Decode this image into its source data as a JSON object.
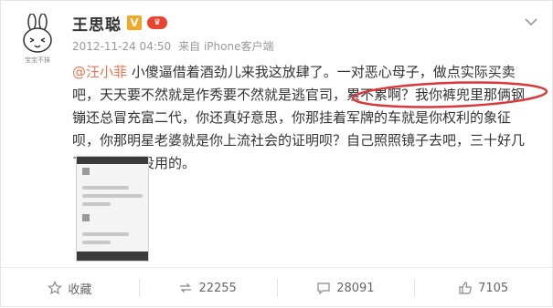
{
  "user": {
    "name": "王思聪",
    "verified_badge": "V",
    "avatar_caption": "宝宝不抹",
    "verified_color": "#f5a623",
    "vip_color": "#e8452f"
  },
  "meta": {
    "timestamp": "2012-11-24 04:50",
    "source": "来自 iPhone客户端"
  },
  "post": {
    "mention": "@汪小菲",
    "text": " 小傻逼借着酒劲儿来我这放肆了。一对恶心母子，做点实际买卖吧，天天要不然就是作秀要不然就是逃官司，累不累啊？我你裤兜里那俩钢镚还总冒充富二代，你还真好意思，你那挂着军牌的车就是你权利的象征呗，你那明星老婆就是你上流社会的证明呗？自己照照镜子去吧，三十好几了整天整些没用的。",
    "mention_color": "#eb7350",
    "highlight_color": "#d9393b"
  },
  "actions": {
    "collect_label": "收藏",
    "repost_count": "22255",
    "comment_count": "28091",
    "like_count": "7105"
  },
  "icons": {
    "more": "chevron-down-icon",
    "collect": "star-icon",
    "repost": "repost-icon",
    "comment": "comment-icon",
    "like": "thumbs-up-icon"
  }
}
